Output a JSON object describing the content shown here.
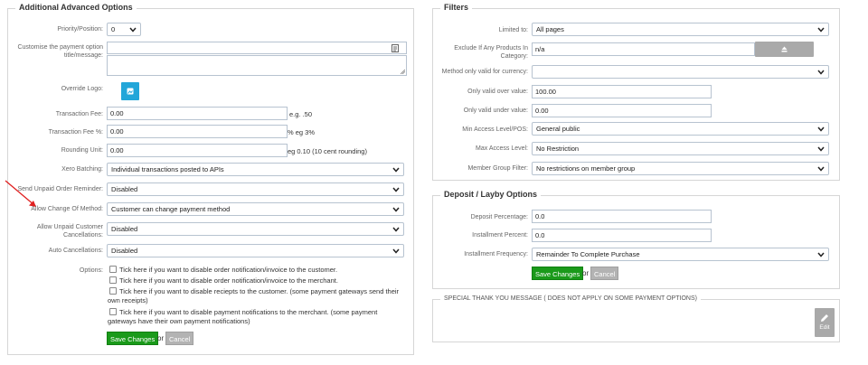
{
  "advanced": {
    "legend": "Additional Advanced Options",
    "priority": {
      "label": "Priority/Position:",
      "value": "0"
    },
    "customise": {
      "label": "Customise the payment option title/message:"
    },
    "override_logo": {
      "label": "Override Logo:"
    },
    "transaction_fee": {
      "label": "Transaction Fee:",
      "value": "0.00",
      "hint": "e.g. .50"
    },
    "transaction_fee_pct": {
      "label": "Transaction Fee %:",
      "value": "0.00",
      "hint": "% eg 3%"
    },
    "rounding": {
      "label": "Rounding Unit:",
      "value": "0.00",
      "hint": "eg 0.10 (10 cent rounding)"
    },
    "xero": {
      "label": "Xero Batching:",
      "value": "Individual transactions posted to APIs"
    },
    "unpaid_reminder": {
      "label": "Send Unpaid Order Reminder:",
      "value": "Disabled"
    },
    "allow_change": {
      "label": "Allow Change Of Method:",
      "value": "Customer can change payment method"
    },
    "unpaid_cancel": {
      "label": "Allow Unpaid Customer Cancellations:",
      "value": "Disabled"
    },
    "auto_cancel": {
      "label": "Auto Cancellations:",
      "value": "Disabled"
    },
    "options_label": "Options:",
    "options": [
      "Tick here if you want to disable order notification/invoice to the customer.",
      "Tick here if you want to disable order notification/invoice to the merchant.",
      "Tick here if you want to disable reciepts to the customer. (some payment gateways send their own receipts)",
      "Tick here if you want to disable payment notifications to the merchant. (some payment gateways have their own payment notifications)"
    ],
    "save_label": "Save Changes",
    "or_label": "or",
    "cancel_label": "Cancel"
  },
  "filters": {
    "legend": "Filters",
    "limited_to": {
      "label": "Limited to:",
      "value": "All pages"
    },
    "exclude": {
      "label": "Exclude If Any Products In Category:",
      "value": "n/a"
    },
    "currency": {
      "label": "Method only valid for currency:",
      "value": ""
    },
    "over": {
      "label": "Only valid over value:",
      "value": "100.00"
    },
    "under": {
      "label": "Only valid under value:",
      "value": "0.00"
    },
    "min_access": {
      "label": "Min Access Level/POS:",
      "value": "General public"
    },
    "max_access": {
      "label": "Max Access Level:",
      "value": "No Restriction"
    },
    "member_group": {
      "label": "Member Group Filter:",
      "value": "No restrictions on member group"
    }
  },
  "deposit": {
    "legend": "Deposit / Layby Options",
    "deposit_pct": {
      "label": "Deposit Percentage:",
      "value": "0.0"
    },
    "installment_pct": {
      "label": "Installment Percent:",
      "value": "0.0"
    },
    "frequency": {
      "label": "Installment Frequency:",
      "value": "Remainder To Complete Purchase"
    },
    "save_label": "Save Changes",
    "or_label": "or",
    "cancel_label": "Cancel"
  },
  "thankyou": {
    "legend": "SPECIAL THANK YOU MESSAGE ( DOES NOT APPLY ON SOME PAYMENT OPTIONS)",
    "edit_label": "Edit"
  },
  "icons": [
    "chevron-down-icon",
    "text-format-icon",
    "image-icon",
    "upload-icon",
    "pencil-icon",
    "arrow-annotation"
  ],
  "colors": {
    "save": "#1a9a1a",
    "cancel": "#b3b3b3",
    "logo": "#22a6d9",
    "annotation": "#e02020"
  }
}
